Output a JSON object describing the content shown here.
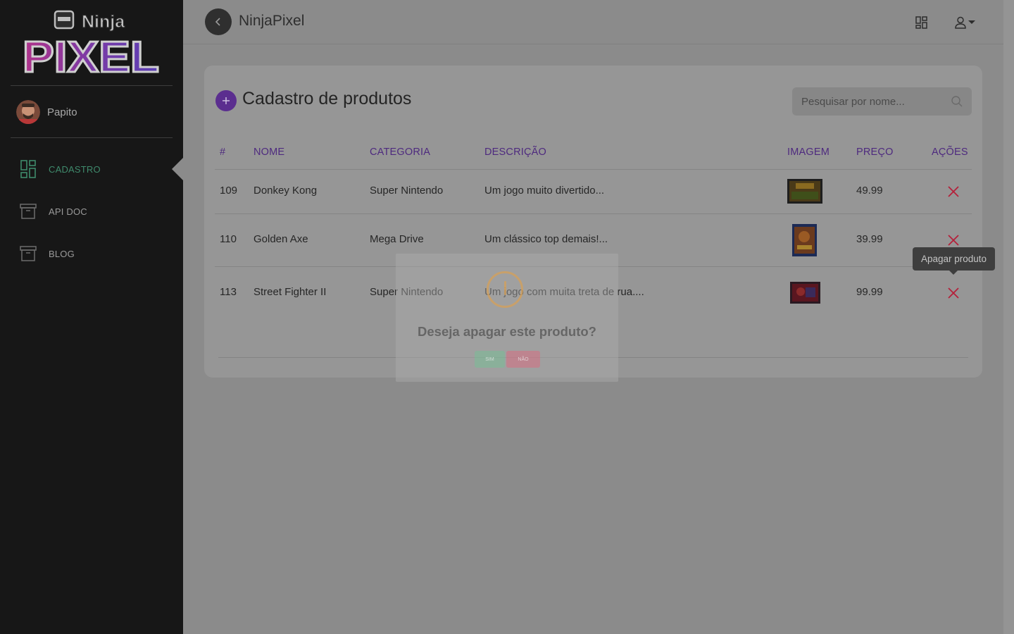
{
  "sidebar": {
    "logo": {
      "top": "Ninja",
      "bottom": "PIXEL"
    },
    "user": {
      "name": "Papito"
    },
    "nav": [
      {
        "label": "CADASTRO",
        "icon": "dashboard-icon",
        "active": true
      },
      {
        "label": "API DOC",
        "icon": "archive-icon",
        "active": false
      },
      {
        "label": "BLOG",
        "icon": "archive-icon",
        "active": false
      }
    ]
  },
  "header": {
    "title": "NinjaPixel"
  },
  "page": {
    "title": "Cadastro de produtos",
    "search_placeholder": "Pesquisar por nome..."
  },
  "table": {
    "columns": [
      "#",
      "NOME",
      "CATEGORIA",
      "DESCRIÇÃO",
      "IMAGEM",
      "PREÇO",
      "AÇÕES"
    ],
    "rows": [
      {
        "id": "109",
        "name": "Donkey Kong",
        "category": "Super Nintendo",
        "description": "Um jogo muito divertido...",
        "price": "49.99"
      },
      {
        "id": "110",
        "name": "Golden Axe",
        "category": "Mega Drive",
        "description": "Um clássico top demais!...",
        "price": "39.99"
      },
      {
        "id": "113",
        "name": "Street Fighter II",
        "category": "Super Nintendo",
        "description": "Um jogo com muita treta de rua....",
        "price": "99.99"
      }
    ]
  },
  "tooltip": {
    "text": "Apagar produto"
  },
  "modal": {
    "message": "Deseja apagar este produto?",
    "confirm_label": "SIM",
    "cancel_label": "NÃO"
  },
  "colors": {
    "sidebar_bg": "#171717",
    "accent_purple": "#5b2e8f",
    "active_green": "#3f8a6c",
    "delete_red": "#b5203a"
  }
}
